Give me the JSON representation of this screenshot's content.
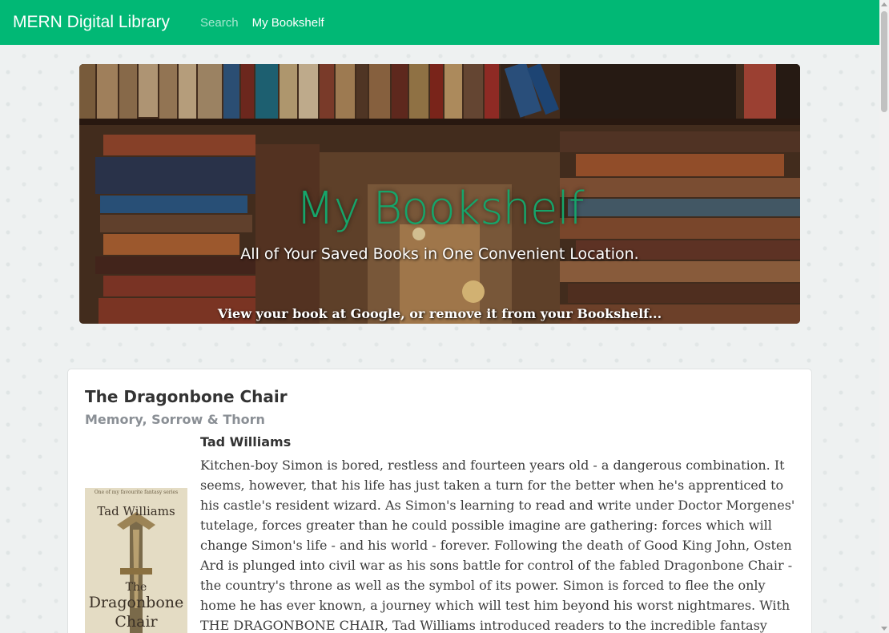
{
  "navbar": {
    "brand": "MERN Digital Library",
    "links": [
      {
        "label": "Search",
        "active": false
      },
      {
        "label": "My Bookshelf",
        "active": true
      }
    ],
    "color": "#01b875"
  },
  "hero": {
    "title": "My Bookshelf",
    "subtitle": "All of Your Saved Books in One Convenient Location.",
    "lead": "View your book at Google, or remove it from your Bookshelf...",
    "title_color": "#16a56a"
  },
  "book": {
    "title": "The Dragonbone Chair",
    "subtitle": "Memory, Sorrow & Thorn",
    "author": "Tad Williams",
    "cover": {
      "author": "Tad Williams",
      "title_line1": "The",
      "title_line2": "Dragonbone",
      "title_line3": "Chair",
      "blurb": "One of my favourite fantasy series"
    },
    "description": "Kitchen-boy Simon is bored, restless and fourteen years old - a dangerous combination. It seems, however, that his life has just taken a turn for the better when he's apprenticed to his castle's resident wizard. As Simon's learning to read and write under Doctor Morgenes' tutelage, forces greater than he could possible imagine are gathering: forces which will change Simon's life - and his world - forever. Following the death of Good King John, Osten Ard is plunged into civil war as his sons battle for control of the fabled Dragonbone Chair - the country's throne as well as the symbol of its power. Simon is forced to flee the only home he has ever known, a journey which will test him beyond his worst nightmares. With THE DRAGONBONE CHAIR, Tad Williams introduced readers to the incredible fantasy world of Osten Ard and kicked off the beloved,"
  }
}
